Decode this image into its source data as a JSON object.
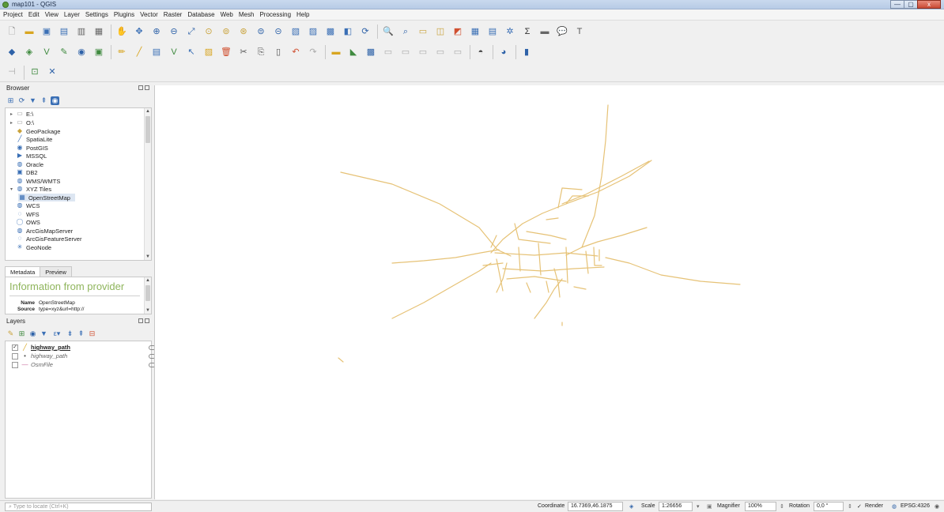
{
  "window": {
    "title": "map101 - QGIS",
    "controls": [
      "—",
      "▢",
      "x"
    ]
  },
  "menu": [
    "Project",
    "Edit",
    "View",
    "Layer",
    "Settings",
    "Plugins",
    "Vector",
    "Raster",
    "Database",
    "Web",
    "Mesh",
    "Processing",
    "Help"
  ],
  "browser": {
    "title": "Browser",
    "items": [
      {
        "label": "E:\\",
        "icon": "folder-icon"
      },
      {
        "label": "O:\\",
        "icon": "folder-icon"
      },
      {
        "label": "GeoPackage",
        "icon": "geopackage-icon"
      },
      {
        "label": "SpatiaLite",
        "icon": "spatialite-icon"
      },
      {
        "label": "PostGIS",
        "icon": "postgis-icon"
      },
      {
        "label": "MSSQL",
        "icon": "mssql-icon"
      },
      {
        "label": "Oracle",
        "icon": "oracle-icon"
      },
      {
        "label": "DB2",
        "icon": "db2-icon"
      },
      {
        "label": "WMS/WMTS",
        "icon": "wms-icon"
      },
      {
        "label": "XYZ Tiles",
        "icon": "xyz-tiles-icon"
      },
      {
        "label": "OpenStreetMap",
        "icon": "openstreetmap-icon"
      },
      {
        "label": "WCS",
        "icon": "wcs-icon"
      },
      {
        "label": "WFS",
        "icon": "wfs-icon"
      },
      {
        "label": "OWS",
        "icon": "ows-icon"
      },
      {
        "label": "ArcGisMapServer",
        "icon": "arcgis-map-icon"
      },
      {
        "label": "ArcGisFeatureServer",
        "icon": "arcgis-feature-icon"
      },
      {
        "label": "GeoNode",
        "icon": "geonode-icon"
      }
    ]
  },
  "info_tabs": [
    "Metadata",
    "Preview"
  ],
  "metadata": {
    "heading": "Information from provider",
    "name_label": "Name",
    "name_value": "OpenStreetMap",
    "source_label": "Source",
    "source_value": "type=xyz&url=http://"
  },
  "layers": {
    "title": "Layers",
    "items": [
      {
        "name": "highway_path",
        "checked": "✓"
      },
      {
        "name": "highway_path",
        "checked": ""
      },
      {
        "name": "OsmFile",
        "checked": ""
      }
    ]
  },
  "status": {
    "locator_placeholder": "Type to locate (Ctrl+K)",
    "coordinate_label": "Coordinate",
    "coordinate_value": "16.7369,46.1875",
    "scale_label": "Scale",
    "scale_value": "1:26656",
    "magnifier_label": "Magnifier",
    "magnifier_value": "100%",
    "rotation_label": "Rotation",
    "rotation_value": "0,0 °",
    "render_label": "Render",
    "crs_label": "EPSG:4326"
  },
  "colors": {
    "road": "#e6c276",
    "metadata_heading": "#8fb55c"
  }
}
